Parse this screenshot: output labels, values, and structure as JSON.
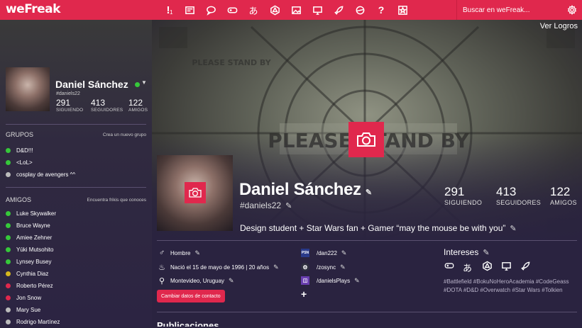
{
  "app": {
    "logo": "weFreak"
  },
  "topbar": {
    "icons": [
      "alert-icon",
      "news-icon",
      "chat-icon",
      "gamepad-icon",
      "anime-icon",
      "dice-icon",
      "gallery-icon",
      "tv-icon",
      "rocket-icon",
      "circle-icon",
      "help-icon",
      "star-icon"
    ],
    "alert_badge": "1",
    "search_placeholder": "Buscar en weFreak..."
  },
  "sidebar": {
    "user": {
      "name": "Daniel Sánchez",
      "handle": "#daniels22",
      "status_color": "#36c83a",
      "stats": [
        {
          "value": "291",
          "label": "SIGUIENDO"
        },
        {
          "value": "413",
          "label": "SEGUIDORES"
        },
        {
          "value": "122",
          "label": "AMIGOS"
        }
      ]
    },
    "groups": {
      "title": "GRUPOS",
      "action": "Crea un nuevo grupo",
      "items": [
        {
          "label": "D&D!!!",
          "color": "#36c83a"
        },
        {
          "label": "<LoL>",
          "color": "#36c83a"
        },
        {
          "label": "cosplay de avengers ^^",
          "color": "#bbbbbb"
        }
      ]
    },
    "friends": {
      "title": "AMIGOS",
      "action": "Encuentra frikis que conoces",
      "items": [
        {
          "label": "Luke Skywalker",
          "color": "#36c83a"
        },
        {
          "label": "Bruce Wayne",
          "color": "#36c83a"
        },
        {
          "label": "Amiee Zehner",
          "color": "#36c83a"
        },
        {
          "label": "Yūki Mutsohito",
          "color": "#36c83a"
        },
        {
          "label": "Lynsey Busey",
          "color": "#36c83a"
        },
        {
          "label": "Cynthia Diaz",
          "color": "#d6b71e"
        },
        {
          "label": "Roberto Pérez",
          "color": "#e0284d"
        },
        {
          "label": "Jon Snow",
          "color": "#e0284d"
        },
        {
          "label": "Mary Sue",
          "color": "#bbbbbb"
        },
        {
          "label": "Rodrigo Martínez",
          "color": "#bbbbbb"
        }
      ]
    }
  },
  "profile": {
    "cover_text": "PLEASE STAND BY",
    "ver_logros": "Ver Logros",
    "name": "Daniel Sánchez",
    "handle": "#daniels22",
    "stats": [
      {
        "value": "291",
        "label": "SIGUIENDO"
      },
      {
        "value": "413",
        "label": "SEGUIDORES"
      },
      {
        "value": "122",
        "label": "AMIGOS"
      }
    ],
    "bio": "Design student + Star Wars fan + Gamer “may the mouse be with you”",
    "details": {
      "gender": "Hombre",
      "birth": "Nació el 15 de mayo de 1996 | 20 años",
      "location": "Montevideo, Uruguay",
      "contact_button": "Cambiar datos de contacto"
    },
    "accounts": [
      {
        "platform": "psn-icon",
        "handle": "/dan222"
      },
      {
        "platform": "steam-icon",
        "handle": "/zosync"
      },
      {
        "platform": "twitch-icon",
        "handle": "/danielsPlays"
      }
    ],
    "interests": {
      "title": "Intereses",
      "icons": [
        "gamepad-icon",
        "anime-icon",
        "dice-icon",
        "tv-icon",
        "rocket-icon"
      ],
      "tags": "#Battlefield #BokuNoHeroAcademia #CodeGeass #DOTA #D&D #Overwatch #Star Wars #Tolkien"
    },
    "posts_title": "Publicaciones"
  },
  "colors": {
    "accent": "#e0284d",
    "background": "#2a2340",
    "online": "#36c83a",
    "away": "#d6b71e"
  }
}
